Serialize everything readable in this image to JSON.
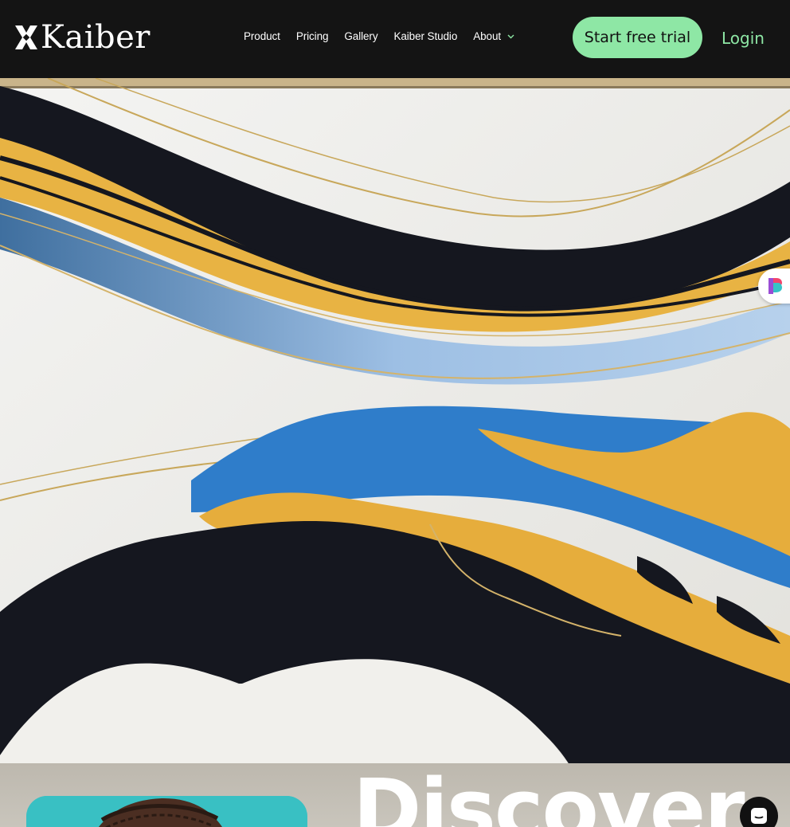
{
  "brand": {
    "name": "Kaiber",
    "logo_icon": "kaiber-k-mark-icon"
  },
  "nav": {
    "items": [
      {
        "label": "Product"
      },
      {
        "label": "Pricing"
      },
      {
        "label": "Gallery"
      },
      {
        "label": "Kaiber Studio"
      },
      {
        "label": "About",
        "icon": "chevron-down-icon"
      }
    ]
  },
  "header": {
    "cta_label": "Start free trial",
    "login_label": "Login"
  },
  "hero": {
    "headline": "Discover"
  },
  "widgets": {
    "side_icon": "extension-logo-icon",
    "chat_icon": "chat-bubble-icon"
  },
  "colors": {
    "header_bg": "#141414",
    "accent_green": "#8ee7a5",
    "art_gold": "#e6ad3c",
    "art_blue": "#2f7dca",
    "art_navy": "#15171f",
    "art_white": "#efeeea"
  }
}
